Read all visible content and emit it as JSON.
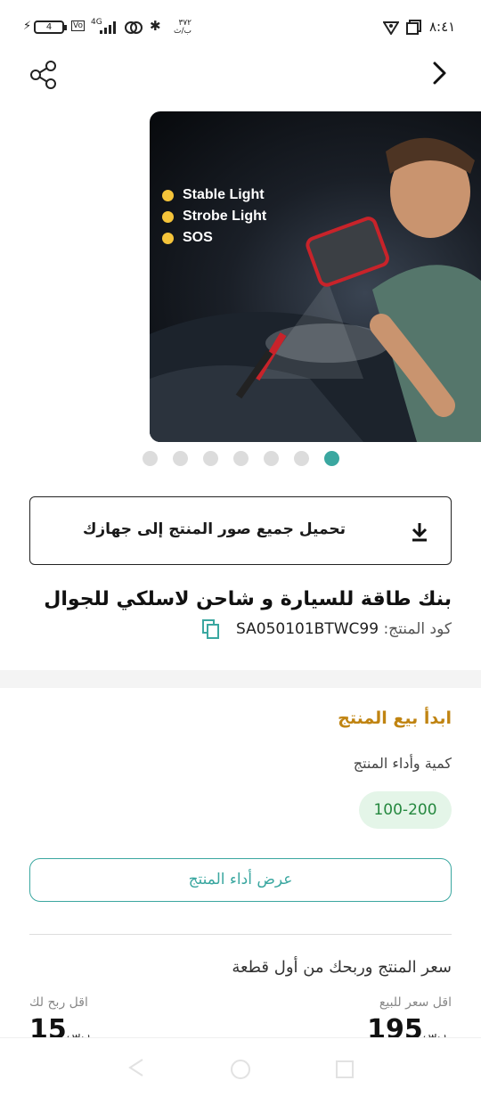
{
  "status_bar": {
    "time": "٨:٤١",
    "battery": "4",
    "network": "4G",
    "data_rate": "٣٧٢ ب/ث"
  },
  "top_bar": {
    "back_icon": "chevron-right-icon",
    "share_icon": "share-icon"
  },
  "gallery": {
    "legend": [
      "Stable Light",
      "Strobe Light",
      "SOS"
    ],
    "dot_count": 7,
    "active_dot_index": 6
  },
  "download": {
    "label": "تحميل جميع صور المنتج إلى جهازك",
    "icon": "download-icon"
  },
  "product": {
    "title": "بنك طاقة للسيارة و شاحن لاسلكي للجوال",
    "code_label": "كود المنتج:",
    "code_value": "SA050101BTWC99",
    "copy_icon": "copy-icon"
  },
  "sell": {
    "title": "ابدأ بيع المنتج",
    "qty_label": "كمية وأداء المنتج",
    "qty_range": "100-200",
    "perf_button": "عرض أداء المنتج"
  },
  "pricing": {
    "title": "سعر المنتج وربحك من أول قطعة",
    "min_sell_label": "اقل سعر للبيع",
    "min_sell_value": "195",
    "min_profit_label": "اقل ربح لك",
    "min_profit_value": "15",
    "currency": "ر.س"
  },
  "colors": {
    "teal": "#3aa7a0",
    "gold": "#c08412",
    "green_chip_bg": "#e4f5e8",
    "green_chip_text": "#25883f"
  }
}
